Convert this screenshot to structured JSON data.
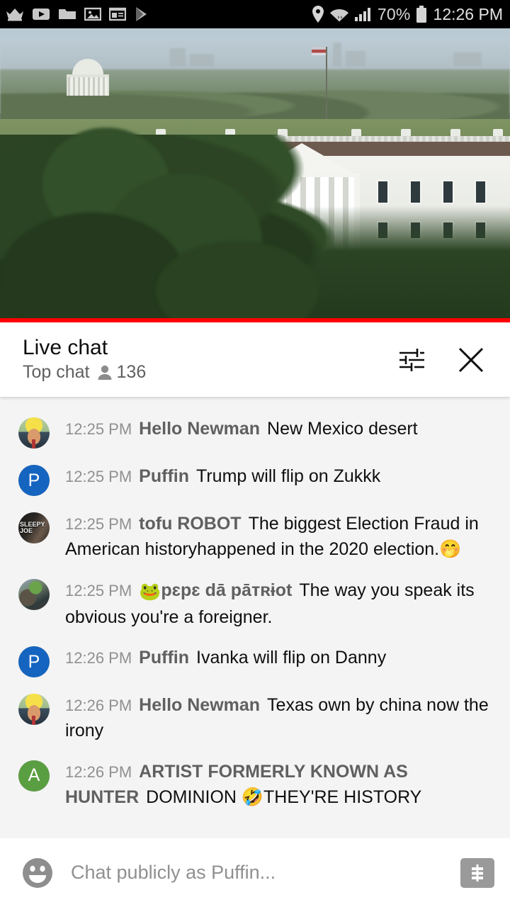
{
  "statusbar": {
    "left_icons": [
      "crown-icon",
      "youtube-icon",
      "folder-icon",
      "photos-icon",
      "news-icon",
      "play-store-icon"
    ],
    "right_icons": [
      "location-icon",
      "wifi-icon",
      "signal-icon",
      "battery-icon"
    ],
    "battery_percent": "70%",
    "clock": "12:26 PM"
  },
  "video": {
    "scene_description": "White House live stream",
    "progress_color": "#ff0000",
    "progress_percent": 100
  },
  "chat_header": {
    "title": "Live chat",
    "mode": "Top chat",
    "viewer_count": "136",
    "settings_icon": "tune-sliders-icon",
    "close_icon": "close-x-icon"
  },
  "messages": [
    {
      "time": "12:25 PM",
      "author": "Hello Newman",
      "author_emoji": "",
      "text": "New Mexico desert",
      "avatar_type": "photo-trump",
      "avatar_letter": ""
    },
    {
      "time": "12:25 PM",
      "author": "Puffin",
      "author_emoji": "",
      "text": "Trump will flip on Zukkk",
      "avatar_type": "letter-blue",
      "avatar_letter": "P"
    },
    {
      "time": "12:25 PM",
      "author": "tofu ROBOT",
      "author_emoji": "",
      "text": "The biggest Election Fraud in American historyhappened in the 2020 election.🤭",
      "avatar_type": "photo-sleepy-joe",
      "avatar_letter": "SLEEPY JOE"
    },
    {
      "time": "12:25 PM",
      "author": "pɛpɛ dā pāтʀɨot",
      "author_emoji": "🐸",
      "text": "The way you speak its obvious you're a foreigner.",
      "avatar_type": "photo-generic",
      "avatar_letter": ""
    },
    {
      "time": "12:26 PM",
      "author": "Puffin",
      "author_emoji": "",
      "text": "Ivanka will flip on Danny",
      "avatar_type": "letter-blue",
      "avatar_letter": "P"
    },
    {
      "time": "12:26 PM",
      "author": "Hello Newman",
      "author_emoji": "",
      "text": "Texas own by china now the irony",
      "avatar_type": "photo-trump",
      "avatar_letter": ""
    },
    {
      "time": "12:26 PM",
      "author": "ARTIST FORMERLY KNOWN AS HUNTER",
      "author_emoji": "",
      "text": "DOMINION 🤣THEY'RE HISTORY",
      "avatar_type": "letter-green",
      "avatar_letter": "A"
    }
  ],
  "chat_input": {
    "emoji_icon": "emoji-face-icon",
    "placeholder": "Chat publicly as Puffin...",
    "superchat_icon": "dollar-superchat-icon"
  },
  "colors": {
    "accent_red": "#ff0000",
    "chat_bg": "#f4f4f4",
    "avatar_blue": "#1565c0",
    "avatar_green": "#5a9e42",
    "status_bar": "#000000"
  }
}
